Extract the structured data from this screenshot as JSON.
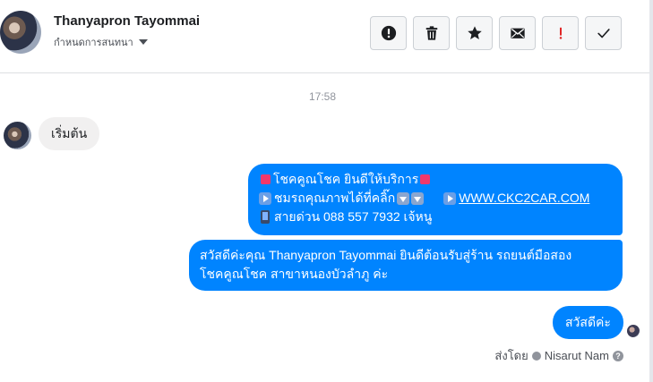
{
  "header": {
    "contact_name": "Thanyapron Tayommai",
    "conversation_settings": "กำหนดการสนทนา",
    "toolbar": [
      {
        "name": "report-spam-button",
        "icon": "alert-circle-icon"
      },
      {
        "name": "delete-button",
        "icon": "trash-icon"
      },
      {
        "name": "star-button",
        "icon": "star-icon"
      },
      {
        "name": "mark-unread-button",
        "icon": "envelope-icon"
      },
      {
        "name": "important-button",
        "icon": "exclamation-icon"
      },
      {
        "name": "mark-done-button",
        "icon": "check-icon"
      }
    ]
  },
  "thread": {
    "timestamp": "17:58",
    "incoming_message": "เริ่มต้น",
    "outgoing_1": {
      "line1": "โชคคูณโชค ยินดีให้บริการ",
      "line2_text": "ชมรถคุณภาพได้ที่คลิ๊ก",
      "line2_link": "WWW.CKC2CAR.COM",
      "line3": "สายด่วน 088 557 7932 เจ้หนู"
    },
    "outgoing_2": {
      "line1": "สวัสดีค่ะคุณ Thanyapron Tayommai ยินดีต้อนรับสู่ร้าน รถยนต์มือสอง",
      "line2": "โชคคูณโชค สาขาหนองบัวลำภู ค่ะ"
    },
    "outgoing_3": "สวัสดีค่ะ",
    "sent_by_label": "ส่งโดย",
    "sent_by_name": "Nisarut Nam",
    "help_glyph": "?"
  },
  "colors": {
    "outgoing_bubble": "#0084ff",
    "incoming_bubble": "#f1f0f0",
    "important_icon": "#e02424"
  }
}
